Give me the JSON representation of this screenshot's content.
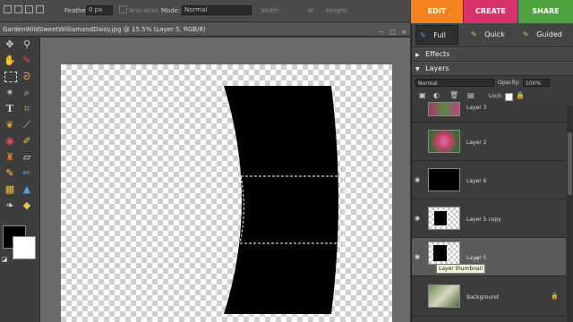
{
  "options_bar": {
    "feather_label": "Feather:",
    "feather_value": "0 px",
    "antialias_label": "Anti-alias",
    "mode_label": "Mode:",
    "mode_value": "Normal",
    "width_label": "Width:",
    "height_label": "Height:"
  },
  "mode_buttons": {
    "edit": "EDIT",
    "create": "CREATE",
    "share": "SHARE",
    "colors": {
      "edit": "#f5821f",
      "create": "#d8336a",
      "share": "#4fa33c"
    }
  },
  "document": {
    "title": "GardenWildSweetWilliamandDaisy.jpg @ 15.5% (Layer 5, RGB/8)"
  },
  "panel": {
    "tabs": {
      "full": "Full",
      "quick": "Quick",
      "guided": "Guided"
    },
    "effects_title": "Effects",
    "layers_title": "Layers",
    "blend_mode": "Normal",
    "opacity_label": "Opacity:",
    "opacity_value": "100%",
    "lock_label": "Lock:",
    "layers": [
      {
        "name": "Layer 3",
        "visible": false
      },
      {
        "name": "Layer 2",
        "visible": false
      },
      {
        "name": "Layer 6",
        "visible": true
      },
      {
        "name": "Layer 5 copy",
        "visible": true
      },
      {
        "name": "Layer 5",
        "visible": true
      },
      {
        "name": "Background",
        "visible": false
      }
    ],
    "tooltip": "Layer thumbnail"
  }
}
